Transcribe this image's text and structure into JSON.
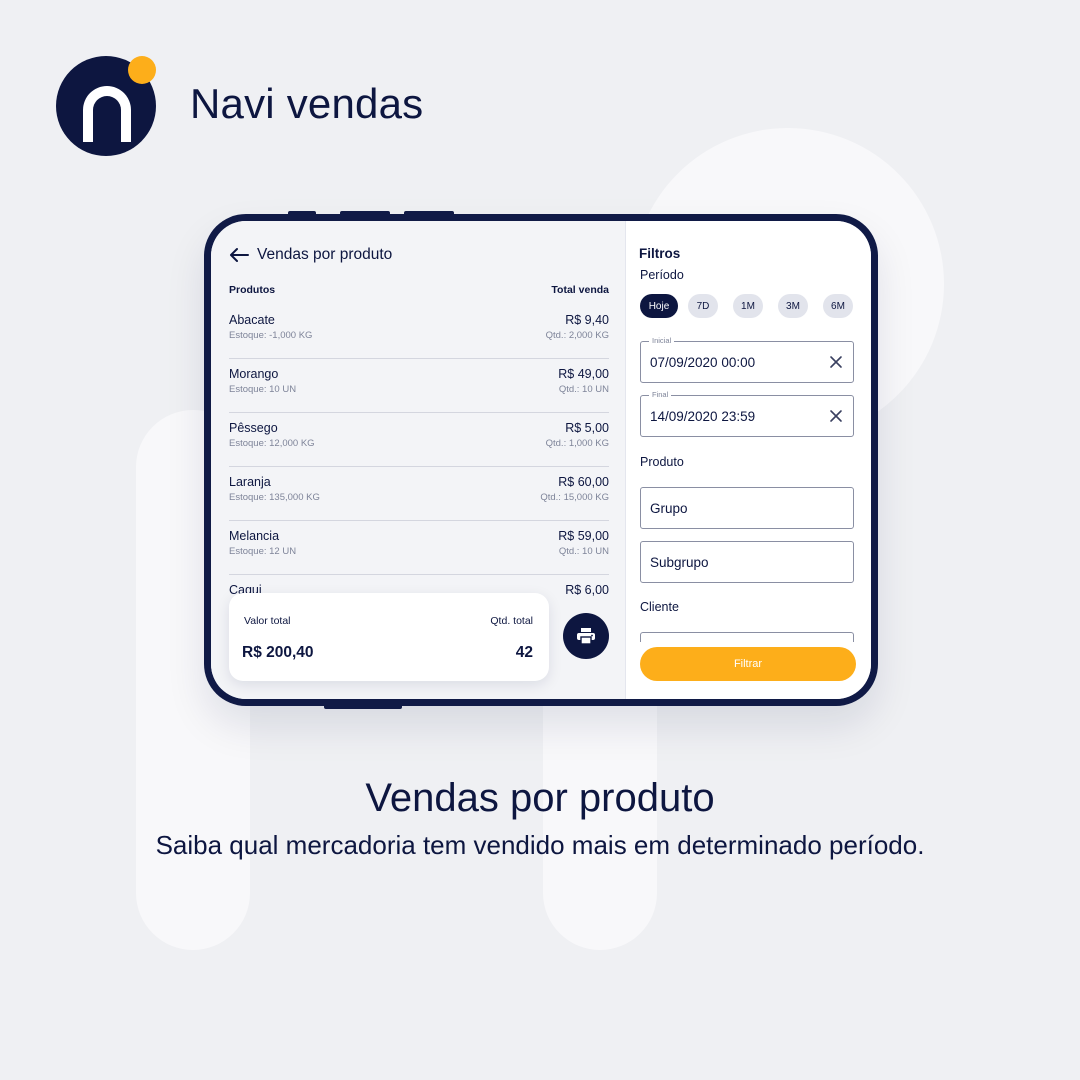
{
  "brand": {
    "name": "Navi vendas",
    "colors": {
      "navy": "#0d1640",
      "accent": "#fdae1a"
    }
  },
  "screen": {
    "title": "Vendas por produto",
    "columns": {
      "product": "Produtos",
      "total": "Total venda"
    },
    "items": [
      {
        "name": "Abacate",
        "stock": "Estoque: -1,000 KG",
        "price": "R$ 9,40",
        "qty": "Qtd.: 2,000 KG"
      },
      {
        "name": "Morango",
        "stock": "Estoque: 10 UN",
        "price": "R$ 49,00",
        "qty": "Qtd.: 10 UN"
      },
      {
        "name": "Pêssego",
        "stock": "Estoque: 12,000 KG",
        "price": "R$ 5,00",
        "qty": "Qtd.: 1,000 KG"
      },
      {
        "name": "Laranja",
        "stock": "Estoque: 135,000 KG",
        "price": "R$ 60,00",
        "qty": "Qtd.: 15,000 KG"
      },
      {
        "name": "Melancia",
        "stock": "Estoque: 12 UN",
        "price": "R$ 59,00",
        "qty": "Qtd.: 10 UN"
      },
      {
        "name": "Caqui",
        "stock": "",
        "price": "R$ 6,00",
        "qty": ""
      }
    ],
    "summary": {
      "total_label": "Valor total",
      "qty_label": "Qtd. total",
      "total_value": "R$ 200,40",
      "qty_value": "42"
    }
  },
  "filters": {
    "title": "Filtros",
    "period_label": "Período",
    "chips": [
      "Hoje",
      "7D",
      "1M",
      "3M",
      "6M"
    ],
    "selected_chip": "Hoje",
    "start": {
      "label": "Inicial",
      "value": "07/09/2020   00:00"
    },
    "end": {
      "label": "Final",
      "value": "14/09/2020   23:59"
    },
    "product_label": "Produto",
    "group_placeholder": "Grupo",
    "subgroup_placeholder": "Subgrupo",
    "client_label": "Cliente",
    "submit_label": "Filtrar"
  },
  "feature": {
    "headline": "Vendas por produto",
    "tagline": "Saiba qual mercadoria tem vendido mais em determinado período."
  }
}
